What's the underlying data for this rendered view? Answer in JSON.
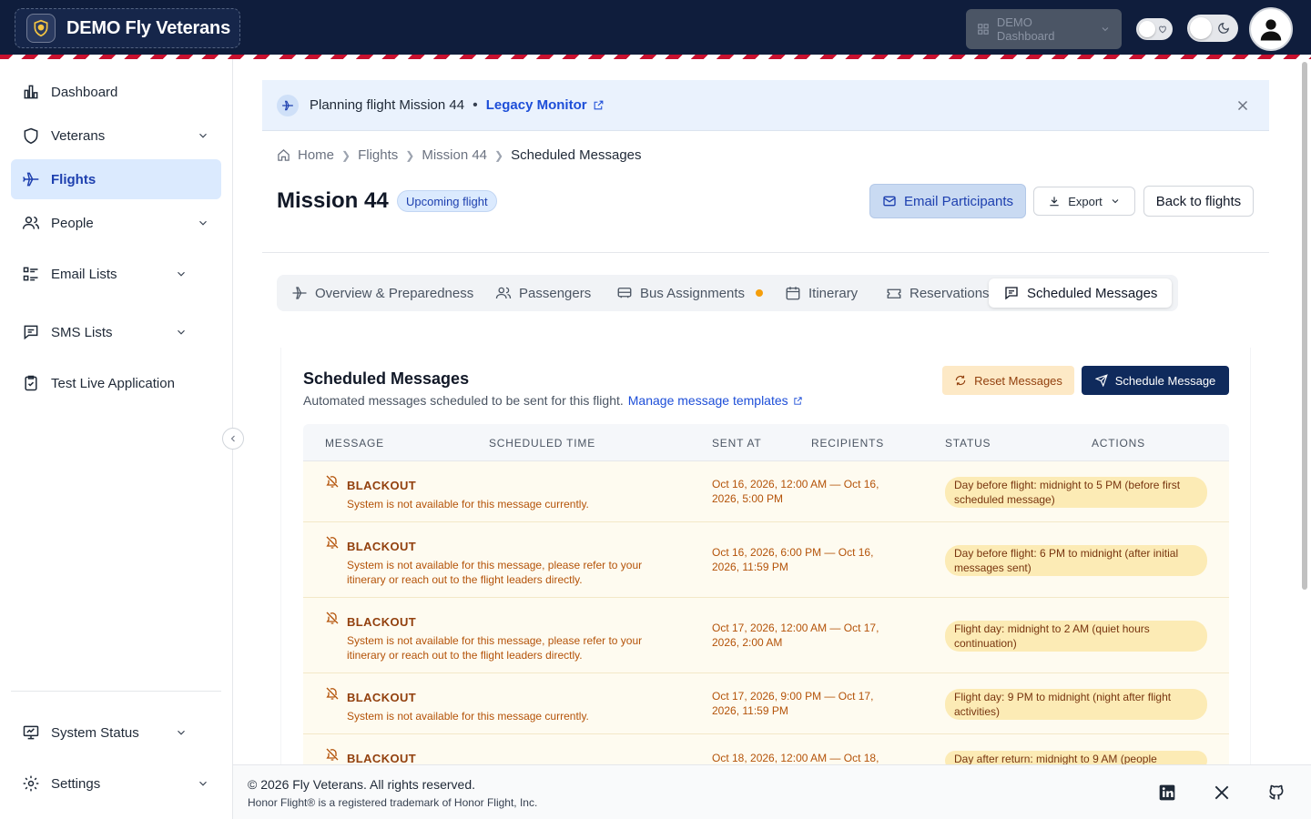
{
  "brand": {
    "name": "DEMO Fly Veterans"
  },
  "header": {
    "dashboard_select": "DEMO Dashboard"
  },
  "sidebar": {
    "items": [
      {
        "label": "Dashboard"
      },
      {
        "label": "Veterans"
      },
      {
        "label": "Flights"
      },
      {
        "label": "People"
      },
      {
        "label": "Email Lists"
      },
      {
        "label": "SMS Lists"
      },
      {
        "label": "Test Live Application"
      },
      {
        "label": "System Status"
      },
      {
        "label": "Settings"
      }
    ]
  },
  "banner": {
    "text": "Planning flight Mission 44",
    "separator": "•",
    "link": "Legacy Monitor"
  },
  "breadcrumb": [
    "Home",
    "Flights",
    "Mission 44",
    "Scheduled Messages"
  ],
  "page": {
    "title": "Mission 44",
    "badge": "Upcoming flight",
    "email_button": "Email Participants",
    "export_button": "Export",
    "back_button": "Back to flights"
  },
  "tabs": [
    {
      "label": "Overview & Preparedness"
    },
    {
      "label": "Passengers"
    },
    {
      "label": "Bus Assignments"
    },
    {
      "label": "Itinerary"
    },
    {
      "label": "Reservations"
    },
    {
      "label": "Scheduled Messages"
    }
  ],
  "card": {
    "title": "Scheduled Messages",
    "subtitle": "Automated messages scheduled to be sent for this flight.",
    "subtitle_link": "Manage message templates",
    "reset_button": "Reset Messages",
    "schedule_button": "Schedule Message"
  },
  "table": {
    "headers": [
      "MESSAGE",
      "SCHEDULED TIME",
      "SENT AT",
      "RECIPIENTS",
      "STATUS",
      "ACTIONS"
    ],
    "rows": [
      {
        "title": "BLACKOUT",
        "description": "System is not available for this message currently.",
        "sent_at": "Oct 16, 2026, 12:00 AM — Oct 16, 2026, 5:00 PM",
        "status": "Day before flight: midnight to 5 PM (before first scheduled message)"
      },
      {
        "title": "BLACKOUT",
        "description": "System is not available for this message, please refer to your itinerary or reach out to the flight leaders directly.",
        "sent_at": "Oct 16, 2026, 6:00 PM — Oct 16, 2026, 11:59 PM",
        "status": "Day before flight: 6 PM to midnight (after initial messages sent)"
      },
      {
        "title": "BLACKOUT",
        "description": "System is not available for this message, please refer to your itinerary or reach out to the flight leaders directly.",
        "sent_at": "Oct 17, 2026, 12:00 AM — Oct 17, 2026, 2:00 AM",
        "status": "Flight day: midnight to 2 AM (quiet hours continuation)"
      },
      {
        "title": "BLACKOUT",
        "description": "System is not available for this message currently.",
        "sent_at": "Oct 17, 2026, 9:00 PM — Oct 17, 2026, 11:59 PM",
        "status": "Flight day: 9 PM to midnight (night after flight activities)"
      },
      {
        "title": "BLACKOUT",
        "description": "",
        "sent_at": "Oct 18, 2026, 12:00 AM — Oct 18,",
        "status": "Day after return: midnight to 9 AM (people"
      }
    ]
  },
  "footer": {
    "copyright": "© 2026 Fly Veterans. All rights reserved.",
    "trademark": "Honor Flight® is a registered trademark of Honor Flight, Inc."
  },
  "colors": {
    "header_bg": "#0f1d3c",
    "accent": "#1d4ed8",
    "blackout_bg": "#fefbf0",
    "blackout_text": "#b45309",
    "status_pill": "#fcebb5"
  }
}
